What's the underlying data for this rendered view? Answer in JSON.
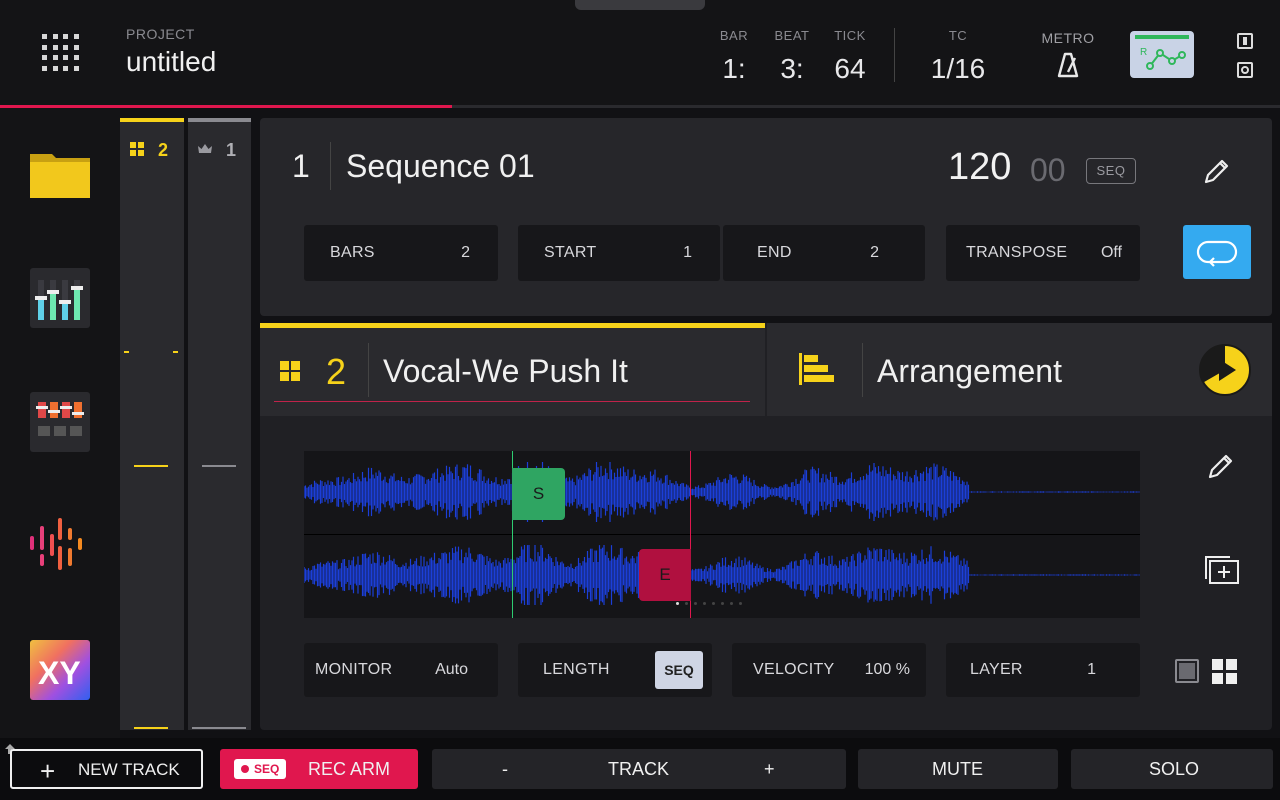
{
  "header": {
    "project_label": "PROJECT",
    "project_name": "untitled",
    "bar_label": "BAR",
    "bar_value": "1:",
    "beat_label": "BEAT",
    "beat_value": "3:",
    "tick_label": "TICK",
    "tick_value": "64",
    "tc_label": "TC",
    "tc_value": "1/16",
    "metro_label": "METRO",
    "playhead_progress": 0.353
  },
  "strips": {
    "track_count_num": "2",
    "song_num": "1"
  },
  "sequence": {
    "number": "1",
    "name": "Sequence 01",
    "bpm": "120",
    "bpm_decimal": "00",
    "badge": "SEQ",
    "params": [
      {
        "label": "BARS",
        "value": "2"
      },
      {
        "label": "START",
        "value": "1"
      },
      {
        "label": "END",
        "value": "2"
      },
      {
        "label": "TRANSPOSE",
        "value": "Off"
      }
    ]
  },
  "track": {
    "number": "2",
    "name": "Vocal-We Push It",
    "arrangement_label": "Arrangement",
    "start_marker": "S",
    "end_marker": "E",
    "params": [
      {
        "label": "MONITOR",
        "value": "Auto"
      },
      {
        "label": "LENGTH",
        "value": "SEQ"
      },
      {
        "label": "VELOCITY",
        "value": "100 %"
      },
      {
        "label": "LAYER",
        "value": "1"
      }
    ]
  },
  "bottom": {
    "new_track": "NEW TRACK",
    "seq_badge": "SEQ",
    "rec_arm": "REC ARM",
    "minus": "-",
    "track": "TRACK",
    "plus": "+",
    "mute": "MUTE",
    "solo": "SOLO"
  },
  "colors": {
    "accent_yellow": "#f6d21a",
    "rec_red": "#e0174e",
    "loop_blue": "#34aaf0",
    "start_green": "#2fa562",
    "end_red": "#b0103f",
    "wave_blue": "#1c3fd8"
  },
  "icons": [
    "grid-menu-icon",
    "metronome-icon",
    "automation-icon",
    "browser-folder-icon",
    "mixer-icon",
    "channel-mixer-icon",
    "sampler-icon",
    "xyfx-icon",
    "pencil-icon",
    "loop-icon",
    "arrangement-icon",
    "pie-play-icon",
    "duplicate-icon",
    "pad-grid-icon"
  ]
}
